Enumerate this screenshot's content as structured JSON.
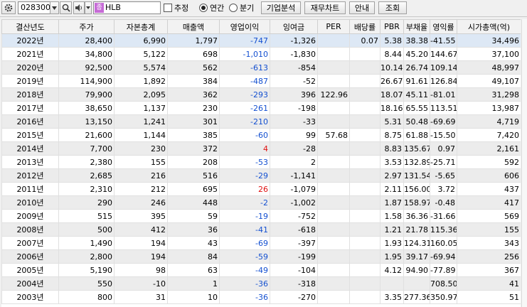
{
  "toolbar": {
    "stock_code": "028300",
    "stock_name": "HLB",
    "name_tag": "종",
    "estimate_label": "추정",
    "annual_label": "연간",
    "quarter_label": "분기",
    "company_analysis_button": "기업분석",
    "financial_chart_button": "재무차트",
    "guide_button": "안내",
    "query_button": "조회"
  },
  "table": {
    "headers": [
      "결산년도",
      "주가",
      "자본총계",
      "매출액",
      "영업이익",
      "잉여금",
      "PER",
      "배당률",
      "PBR",
      "부채율",
      "영익률",
      "시가총액(억)"
    ],
    "rows": [
      [
        "2022년",
        "28,400",
        "6,990",
        "1,797",
        "-747",
        "-1,326",
        "",
        "0.07",
        "5.38",
        "38.38",
        "-41.55",
        "34,496"
      ],
      [
        "2021년",
        "34,800",
        "5,122",
        "698",
        "-1,010",
        "-1,830",
        "",
        "",
        "8.44",
        "45.20",
        "144.67",
        "37,100"
      ],
      [
        "2020년",
        "92,500",
        "5,574",
        "562",
        "-613",
        "-854",
        "",
        "",
        "10.14",
        "26.74",
        "109.14",
        "48,997"
      ],
      [
        "2019년",
        "114,900",
        "1,892",
        "384",
        "-487",
        "-52",
        "",
        "",
        "26.67",
        "91.61",
        "126.84",
        "49,107"
      ],
      [
        "2018년",
        "79,900",
        "2,095",
        "362",
        "-293",
        "396",
        "122.96",
        "",
        "18.07",
        "45.11",
        "-81.01",
        "31,298"
      ],
      [
        "2017년",
        "38,650",
        "1,137",
        "230",
        "-261",
        "-198",
        "",
        "",
        "18.16",
        "65.55",
        "113.51",
        "13,987"
      ],
      [
        "2016년",
        "13,150",
        "1,241",
        "301",
        "-210",
        "-33",
        "",
        "",
        "5.31",
        "50.48",
        "-69.69",
        "4,719"
      ],
      [
        "2015년",
        "21,600",
        "1,144",
        "385",
        "-60",
        "99",
        "57.68",
        "",
        "8.75",
        "61.88",
        "-15.50",
        "7,420"
      ],
      [
        "2014년",
        "7,700",
        "230",
        "372",
        "4",
        "-28",
        "",
        "",
        "8.83",
        "135.67",
        "0.97",
        "2,161"
      ],
      [
        "2013년",
        "2,380",
        "155",
        "208",
        "-53",
        "2",
        "",
        "",
        "3.53",
        "132.89",
        "-25.71",
        "592"
      ],
      [
        "2012년",
        "2,685",
        "216",
        "516",
        "-29",
        "-1,141",
        "",
        "",
        "2.97",
        "131.54",
        "-5.65",
        "606"
      ],
      [
        "2011년",
        "2,310",
        "212",
        "695",
        "26",
        "-1,079",
        "",
        "",
        "2.11",
        "156.00",
        "3.72",
        "437"
      ],
      [
        "2010년",
        "290",
        "246",
        "448",
        "-2",
        "-1,002",
        "",
        "",
        "1.87",
        "158.97",
        "-0.48",
        "417"
      ],
      [
        "2009년",
        "515",
        "395",
        "59",
        "-19",
        "-752",
        "",
        "",
        "1.58",
        "36.36",
        "-31.66",
        "569"
      ],
      [
        "2008년",
        "500",
        "412",
        "36",
        "-41",
        "-618",
        "",
        "",
        "1.21",
        "21.78",
        "115.36",
        "155"
      ],
      [
        "2007년",
        "1,490",
        "194",
        "43",
        "-69",
        "-397",
        "",
        "",
        "1.93",
        "124.31",
        "160.05",
        "343"
      ],
      [
        "2006년",
        "2,800",
        "194",
        "84",
        "-59",
        "-199",
        "",
        "",
        "1.95",
        "39.17",
        "-69.94",
        "256"
      ],
      [
        "2005년",
        "5,190",
        "98",
        "63",
        "-49",
        "-104",
        "",
        "",
        "4.12",
        "94.90",
        "-77.89",
        "367"
      ],
      [
        "2004년",
        "550",
        "-10",
        "1",
        "-36",
        "-318",
        "",
        "",
        "",
        "",
        "708.50",
        "41"
      ],
      [
        "2003년",
        "800",
        "31",
        "10",
        "-36",
        "-270",
        "",
        "",
        "3.35",
        "277.36",
        "350.97",
        "51"
      ]
    ]
  },
  "colors": {
    "negative": "#1450d0",
    "positive": "#e01010",
    "selected_row": "#dde8f5"
  }
}
